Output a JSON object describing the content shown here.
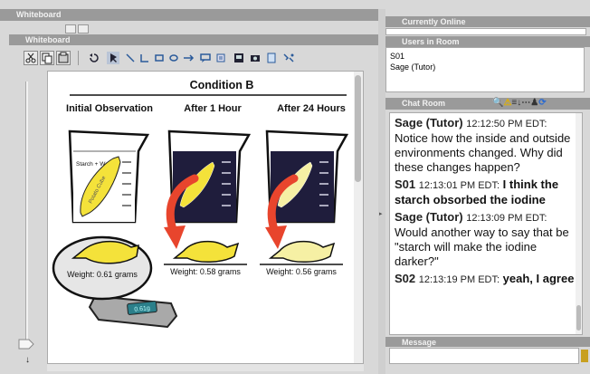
{
  "whiteboard": {
    "title": "Whiteboard",
    "subtitle": "Whiteboard",
    "tools": [
      "scissors-icon",
      "copy-icon",
      "paste-icon",
      "undo-icon",
      "select-icon",
      "line-icon",
      "connector-icon",
      "rectangle-icon",
      "ellipse-icon",
      "arrow-icon",
      "callout-icon",
      "text-icon",
      "image-icon",
      "camera-icon",
      "embed-icon",
      "link-icon"
    ]
  },
  "figure": {
    "title": "Condition B",
    "col1": "Initial Observation",
    "col2": "After 1 Hour",
    "col3": "After 24 Hours",
    "beaker_label": "Starch + Water",
    "potato_label": "Potato Cube",
    "weight1": "Weight: 0.61 grams",
    "weight2": "Weight: 0.58 grams",
    "weight3": "Weight: 0.56 grams",
    "scale_display": "0.61g"
  },
  "right": {
    "currently_header": "Currently Online",
    "users_header": "Users in Room",
    "users": [
      "S01",
      "Sage (Tutor)"
    ],
    "chat_header": "Chat Room",
    "messages": [
      {
        "name": "Sage (Tutor)",
        "time": "12:12:50 PM EDT:",
        "text": "Notice how the inside and outside environments changed. Why did these changes happen?",
        "bold": false
      },
      {
        "name": "S01",
        "time": "12:13:01 PM EDT:",
        "text": "I think the starch obsorbed the iodine",
        "bold": true
      },
      {
        "name": "Sage (Tutor)",
        "time": "12:13:09 PM EDT:",
        "text": "Would another way to say that be \"starch will make the iodine darker?\"",
        "bold": false
      },
      {
        "name": "S02",
        "time": "12:13:19 PM EDT:",
        "text": "yeah, I agree",
        "bold": true
      }
    ],
    "message_header": "Message",
    "message_value": ""
  },
  "colors": {
    "panel": "#9a9a9a",
    "canvas": "#ffffff",
    "yellow": "#f4e23a",
    "pale": "#f6f0a4",
    "navy": "#1f1d3c",
    "red": "#e8452d"
  }
}
